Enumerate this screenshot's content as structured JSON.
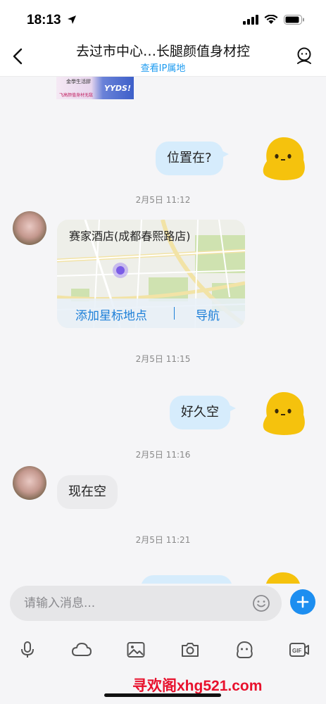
{
  "status_bar": {
    "time": "18:13"
  },
  "header": {
    "title": "去过市中心…长腿颜值身材控",
    "subtitle": "查看IP属地"
  },
  "thumbnail": {
    "caption": "金學生活膠",
    "sub_caption": "飞高颜值身材无敌",
    "badge": "YYDS!"
  },
  "messages": {
    "m1": {
      "text": "位置在?"
    },
    "ts1": "2月5日 11:12",
    "location": {
      "name": "赛家酒店(成都春熙路店)",
      "star_action": "添加星标地点",
      "separator": "|",
      "navigate_action": "导航"
    },
    "ts2": "2月5日 11:15",
    "m2": {
      "text": "好久空"
    },
    "ts3": "2月5日 11:16",
    "m3": {
      "text": "现在空"
    },
    "ts4": "2月5日 11:21"
  },
  "input": {
    "placeholder": "请输入消息..."
  },
  "toolbar": {
    "items": [
      "microphone-icon",
      "cloud-icon",
      "image-icon",
      "camera-icon",
      "sticker-icon",
      "gif-icon"
    ]
  },
  "watermark": "寻欢阁xhg521.com",
  "colors": {
    "accent": "#1d8ef0",
    "outgoing_bubble": "#d6ecfc",
    "incoming_bubble": "#ebebed",
    "watermark": "#e8112d"
  }
}
